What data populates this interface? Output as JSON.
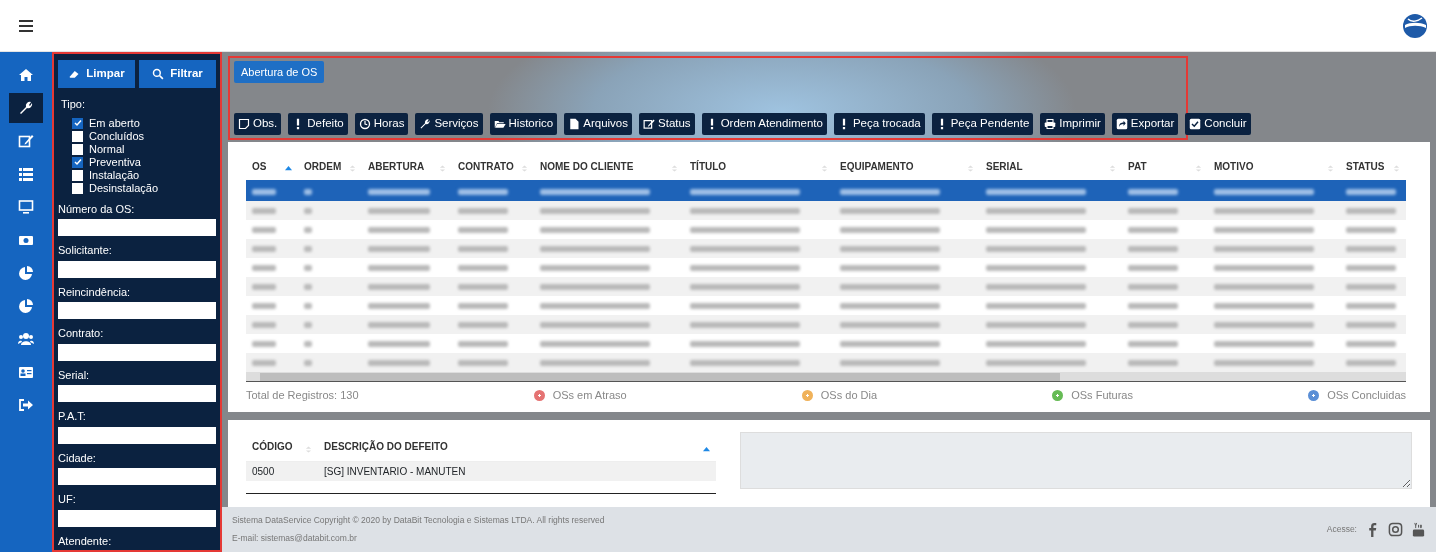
{
  "rail": {
    "items": [
      {
        "kind": "home",
        "selected": false
      },
      {
        "kind": "wrench",
        "selected": true
      },
      {
        "kind": "edit",
        "selected": false
      },
      {
        "kind": "list",
        "selected": false
      },
      {
        "kind": "monitor",
        "selected": false
      },
      {
        "kind": "money",
        "selected": false
      },
      {
        "kind": "pie",
        "selected": false
      },
      {
        "kind": "pie",
        "selected": false
      },
      {
        "kind": "users",
        "selected": false
      },
      {
        "kind": "card",
        "selected": false
      },
      {
        "kind": "exit",
        "selected": false
      }
    ]
  },
  "filters": {
    "buttons": [
      {
        "kind": "eraser",
        "label": "Limpar"
      },
      {
        "kind": "search",
        "label": "Filtrar"
      }
    ],
    "types_label": "Tipo:",
    "types": [
      {
        "label": "Em aberto",
        "checked": true
      },
      {
        "label": "Concluídos",
        "checked": false
      },
      {
        "label": "Normal",
        "checked": false
      },
      {
        "label": "Preventiva",
        "checked": true
      },
      {
        "label": "Instalação",
        "checked": false
      },
      {
        "label": "Desinstalação",
        "checked": false
      }
    ],
    "fields": [
      {
        "label": "Número da OS:"
      },
      {
        "label": "Solicitante:"
      },
      {
        "label": "Reincindência:"
      },
      {
        "label": "Contrato:"
      },
      {
        "label": "Serial:"
      },
      {
        "label": "P.A.T:"
      },
      {
        "label": "Cidade:"
      },
      {
        "label": "UF:"
      },
      {
        "label": "Atendente:"
      }
    ]
  },
  "toolbar": {
    "title": "Abertura de OS",
    "actions": [
      {
        "kind": "note",
        "label": "Obs."
      },
      {
        "kind": "alert",
        "label": "Defeito"
      },
      {
        "kind": "clock",
        "label": "Horas"
      },
      {
        "kind": "wrench",
        "label": "Serviços"
      },
      {
        "kind": "folder",
        "label": "Historico"
      },
      {
        "kind": "file",
        "label": "Arquivos"
      },
      {
        "kind": "edit",
        "label": "Status"
      },
      {
        "kind": "alert",
        "label": "Ordem Atendimento"
      },
      {
        "kind": "alert",
        "label": "Peça trocada"
      },
      {
        "kind": "alert",
        "label": "Peça Pendente"
      },
      {
        "kind": "print",
        "label": "Imprimir"
      },
      {
        "kind": "share",
        "label": "Exportar"
      },
      {
        "kind": "check",
        "label": "Concluir"
      }
    ]
  },
  "table": {
    "columns": [
      {
        "label": "OS",
        "sorted": true
      },
      {
        "label": "ORDEM",
        "sorted": false
      },
      {
        "label": "ABERTURA",
        "sorted": false
      },
      {
        "label": "CONTRATO",
        "sorted": false
      },
      {
        "label": "NOME DO CLIENTE",
        "sorted": false
      },
      {
        "label": "TÍTULO",
        "sorted": false
      },
      {
        "label": "EQUIPAMENTO",
        "sorted": false
      },
      {
        "label": "SERIAL",
        "sorted": false
      },
      {
        "label": "PAT",
        "sorted": false
      },
      {
        "label": "MOTIVO",
        "sorted": false
      },
      {
        "label": "STATUS",
        "sorted": false
      }
    ],
    "rows": [
      {
        "selected": true
      },
      {
        "selected": false
      },
      {
        "selected": false
      },
      {
        "selected": false
      },
      {
        "selected": false
      },
      {
        "selected": false
      },
      {
        "selected": false
      },
      {
        "selected": false
      },
      {
        "selected": false
      },
      {
        "selected": false
      }
    ],
    "total": "Total de Registros: 130",
    "legend": [
      {
        "label": "OSs em Atraso",
        "color": "#e57373"
      },
      {
        "label": "OSs do Dia",
        "color": "#f0b25a"
      },
      {
        "label": "OSs Futuras",
        "color": "#66bb55"
      },
      {
        "label": "OSs Concluidas",
        "color": "#5b8fd6"
      }
    ]
  },
  "defects": {
    "columns": [
      {
        "label": "CÓDIGO",
        "sorted": false
      },
      {
        "label": "DESCRIÇÃO DO DEFEITO",
        "sorted": true
      }
    ],
    "rows": [
      [
        "0500",
        "[SG] INVENTARIO - MANUTEN"
      ]
    ]
  },
  "footer": {
    "copyright": "Sistema DataService Copyright © 2020 by DataBit Tecnologia e Sistemas LTDA. All rights reserved",
    "email": "E-mail: sistemas@databit.com.br",
    "social_label": "Acesse:",
    "social": [
      {
        "kind": "facebook"
      },
      {
        "kind": "instagram"
      },
      {
        "kind": "youtube"
      }
    ]
  }
}
